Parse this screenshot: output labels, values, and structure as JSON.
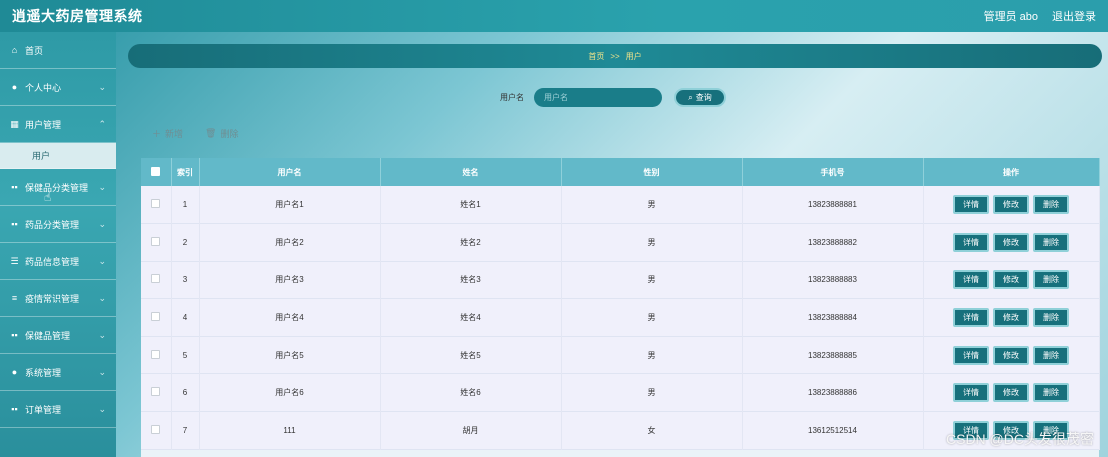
{
  "header": {
    "title": "逍遥大药房管理系统",
    "admin_label": "管理员 abo",
    "logout_label": "退出登录"
  },
  "sidebar": {
    "items": [
      {
        "label": "首页",
        "icon": "home-icon",
        "has_chevron": false
      },
      {
        "label": "个人中心",
        "icon": "user-icon",
        "has_chevron": true
      },
      {
        "label": "用户管理",
        "icon": "table-icon",
        "has_chevron": true
      },
      {
        "label": "保健品分类管理",
        "icon": "grid-icon",
        "has_chevron": true
      },
      {
        "label": "药品分类管理",
        "icon": "grid-icon",
        "has_chevron": true
      },
      {
        "label": "药品信息管理",
        "icon": "sliders-icon",
        "has_chevron": true
      },
      {
        "label": "疫情常识管理",
        "icon": "list-icon",
        "has_chevron": true
      },
      {
        "label": "保健品管理",
        "icon": "grid-icon",
        "has_chevron": true
      },
      {
        "label": "系统管理",
        "icon": "bulb-icon",
        "has_chevron": true
      },
      {
        "label": "订单管理",
        "icon": "grid-icon",
        "has_chevron": true
      }
    ],
    "submenu_label": "用户"
  },
  "breadcrumb": {
    "home": "首页",
    "separator": ">>",
    "current": "用户"
  },
  "search": {
    "label": "用户名",
    "placeholder": "用户名",
    "button_label": "查询"
  },
  "actions": {
    "add_label": "新增",
    "delete_label": "删除"
  },
  "table": {
    "columns": [
      "索引",
      "用户名",
      "姓名",
      "性别",
      "手机号",
      "操作"
    ],
    "rows": [
      {
        "index": "1",
        "username": "用户名1",
        "name": "姓名1",
        "gender": "男",
        "phone": "13823888881"
      },
      {
        "index": "2",
        "username": "用户名2",
        "name": "姓名2",
        "gender": "男",
        "phone": "13823888882"
      },
      {
        "index": "3",
        "username": "用户名3",
        "name": "姓名3",
        "gender": "男",
        "phone": "13823888883"
      },
      {
        "index": "4",
        "username": "用户名4",
        "name": "姓名4",
        "gender": "男",
        "phone": "13823888884"
      },
      {
        "index": "5",
        "username": "用户名5",
        "name": "姓名5",
        "gender": "男",
        "phone": "13823888885"
      },
      {
        "index": "6",
        "username": "用户名6",
        "name": "姓名6",
        "gender": "男",
        "phone": "13823888886"
      },
      {
        "index": "7",
        "username": "111",
        "name": "胡月",
        "gender": "女",
        "phone": "13612512514"
      }
    ],
    "row_buttons": {
      "detail": "详情",
      "edit": "修改",
      "delete": "删除"
    }
  },
  "watermark": "CSDN @DC头发很茂密"
}
